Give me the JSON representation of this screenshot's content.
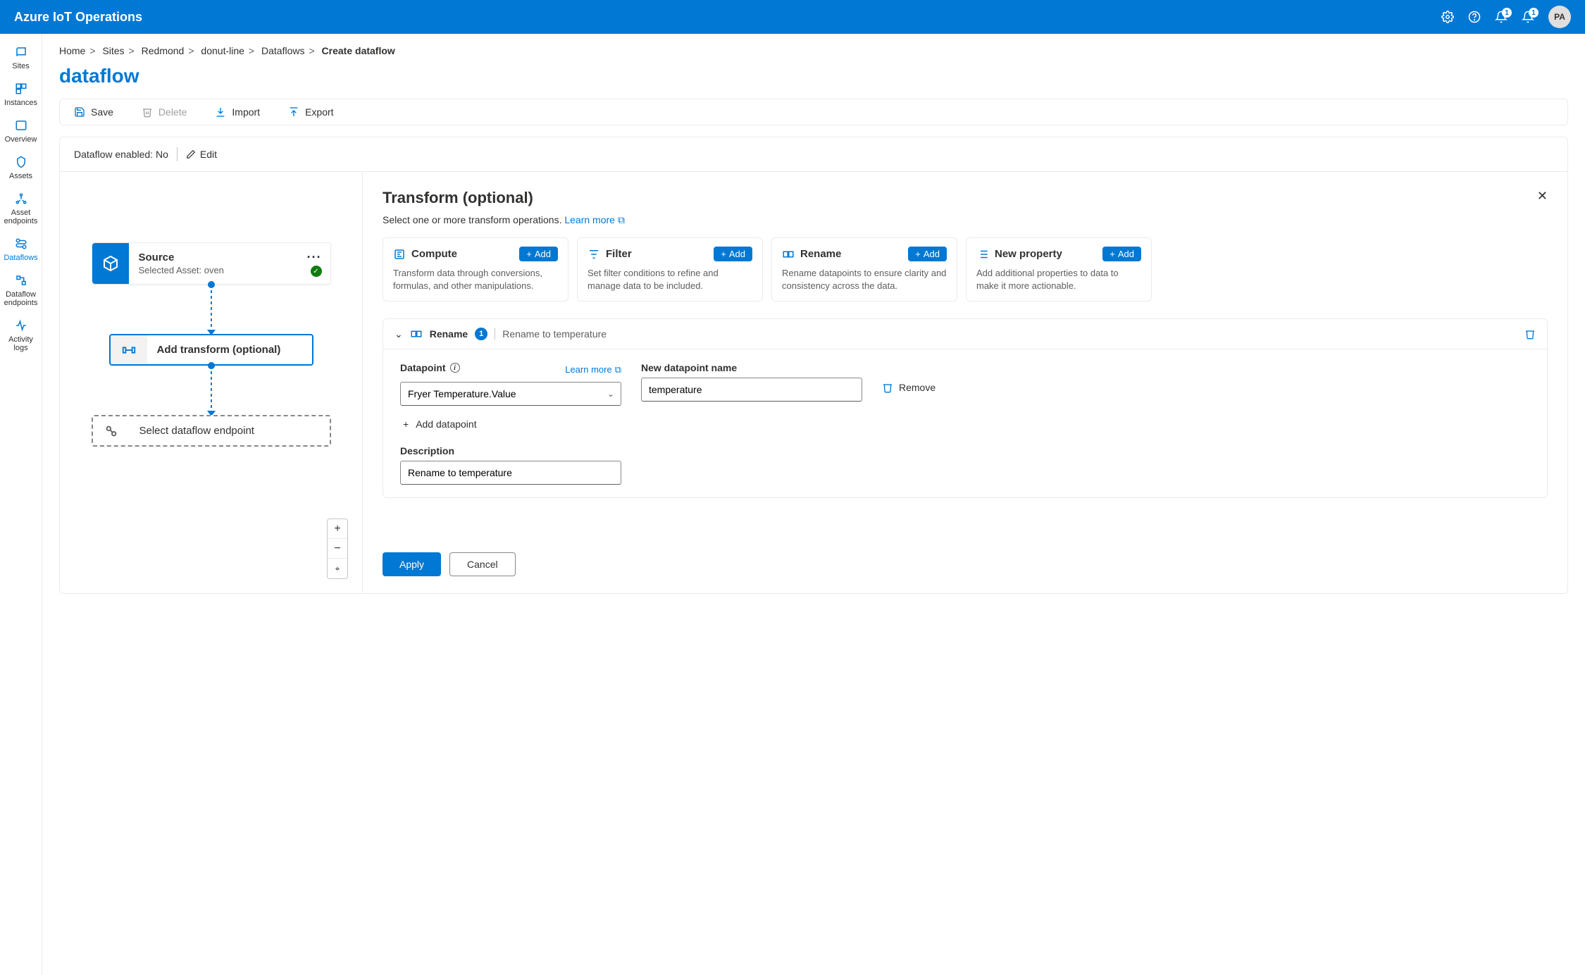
{
  "header": {
    "brand": "Azure IoT Operations",
    "notif1_count": "1",
    "notif2_count": "1",
    "avatar_initials": "PA"
  },
  "sidebar": {
    "items": [
      {
        "label": "Sites"
      },
      {
        "label": "Instances"
      },
      {
        "label": "Overview"
      },
      {
        "label": "Assets"
      },
      {
        "label": "Asset endpoints"
      },
      {
        "label": "Dataflows"
      },
      {
        "label": "Dataflow endpoints"
      },
      {
        "label": "Activity logs"
      }
    ]
  },
  "breadcrumb": {
    "items": [
      "Home",
      "Sites",
      "Redmond",
      "donut-line",
      "Dataflows"
    ],
    "current": "Create dataflow"
  },
  "page_title": "dataflow",
  "toolbar": {
    "save": "Save",
    "delete": "Delete",
    "import": "Import",
    "export": "Export"
  },
  "status": {
    "label": "Dataflow enabled: No",
    "edit": "Edit"
  },
  "flow": {
    "source": {
      "title": "Source",
      "sub": "Selected Asset: oven"
    },
    "transform": {
      "title": "Add transform (optional)"
    },
    "endpoint": {
      "title": "Select dataflow endpoint"
    }
  },
  "panel": {
    "title": "Transform (optional)",
    "subtitle": "Select one or more transform operations.",
    "learn_more": "Learn more",
    "add": "Add",
    "ops": [
      {
        "name": "Compute",
        "desc": "Transform data through conversions, formulas, and other manipulations."
      },
      {
        "name": "Filter",
        "desc": "Set filter conditions to refine and manage data to be included."
      },
      {
        "name": "Rename",
        "desc": "Rename datapoints to ensure clarity and consistency across the data."
      },
      {
        "name": "New property",
        "desc": "Add additional properties to data to make it more actionable."
      }
    ],
    "rename": {
      "label": "Rename",
      "count": "1",
      "description": "Rename to temperature",
      "datapoint_label": "Datapoint",
      "datapoint_value": "Fryer Temperature.Value",
      "newname_label": "New datapoint name",
      "newname_value": "temperature",
      "learn_more": "Learn more",
      "remove": "Remove",
      "add_datapoint": "Add datapoint",
      "desc_label": "Description",
      "desc_value": "Rename to temperature"
    },
    "apply": "Apply",
    "cancel": "Cancel"
  }
}
